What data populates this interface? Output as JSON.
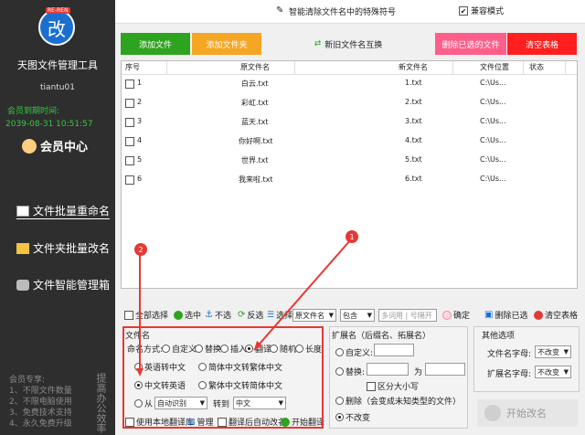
{
  "sidebar": {
    "logo_tag": "RE-REN",
    "logo_glyph": "改",
    "app_title": "天图文件管理工具",
    "username": "tiantu01",
    "expire_label": "会员到期时间:",
    "expire_time": "2039-08-31 10:51:57",
    "member_center": "会员中心",
    "nav": [
      {
        "label": "文件批量重命名",
        "active": true
      },
      {
        "label": "文件夹批量改名",
        "active": false
      },
      {
        "label": "文件智能管理箱",
        "active": false
      }
    ],
    "member_footer": [
      "会员专享:",
      "1、不限文件数量",
      "2、不限电脑使用",
      "3、免费技术支持",
      "4、永久免费升级"
    ],
    "vertical_text": "提高办公效率"
  },
  "topbar": {
    "special_chars_label": "智能清除文件名中的特殊符号",
    "compat_label": "兼容模式"
  },
  "buttons": {
    "add_file": "添加文件",
    "add_folder": "添加文件夹",
    "swap_names": "新旧文件名互换",
    "delete_selected": "删除已选的文件",
    "clear_table": "清空表格"
  },
  "table": {
    "headers": [
      "序号",
      "原文件名",
      "新文件名",
      "文件位置",
      "状态"
    ],
    "rows": [
      {
        "no": "1",
        "orig": "白云.txt",
        "new": "1.txt",
        "loc": "C:\\Us..."
      },
      {
        "no": "2",
        "orig": "彩虹.txt",
        "new": "2.txt",
        "loc": "C:\\Us..."
      },
      {
        "no": "3",
        "orig": "蓝天.txt",
        "new": "3.txt",
        "loc": "C:\\Us..."
      },
      {
        "no": "4",
        "orig": "你好啊.txt",
        "new": "4.txt",
        "loc": "C:\\Us..."
      },
      {
        "no": "5",
        "orig": "世界.txt",
        "new": "5.txt",
        "loc": "C:\\Us..."
      },
      {
        "no": "6",
        "orig": "我来啦.txt",
        "new": "6.txt",
        "loc": "C:\\Us..."
      }
    ]
  },
  "toolbar2": {
    "select_all": "全部选择",
    "select": "选中",
    "deselect": "不选",
    "invert": "反选",
    "choose": "选择:",
    "field_combo": "原文件名",
    "match_combo": "包含",
    "search_placeholder": "多词用 | 号隔开",
    "confirm": "确定",
    "delete_selected": "删除已选",
    "clear_table": "清空表格"
  },
  "filename_panel": {
    "title": "文件名",
    "naming_mode_label": "命名方式:",
    "modes": [
      "自定义",
      "替换",
      "插入",
      "翻译",
      "随机",
      "长度"
    ],
    "selected_mode": "翻译",
    "options": [
      "英语转中文",
      "简体中文转繁体中文",
      "中文转英语",
      "繁体中文转简体中文"
    ],
    "selected_option": "中文转英语",
    "from_label": "从",
    "from_combo": "自动识别",
    "to_label": "转到",
    "to_combo": "中文",
    "use_local": "使用本地翻译库",
    "manage": "管理",
    "auto_rename": "翻译后自动改名",
    "start_translate": "开始翻译"
  },
  "ext_panel": {
    "title": "扩展名（后缀名、拓展名）",
    "custom": "自定义:",
    "replace": "替换:",
    "to": "为",
    "case_sensitive": "区分大小写",
    "delete_label": "删除（会变成未知类型的文件）",
    "no_change": "不改变"
  },
  "other_panel": {
    "title": "其他选项",
    "filename_case_label": "文件名字母:",
    "filename_case": "不改变",
    "ext_case_label": "扩展名字母:",
    "ext_case": "不改变"
  },
  "start_rename": "开始改名",
  "badges": [
    "1",
    "2"
  ]
}
